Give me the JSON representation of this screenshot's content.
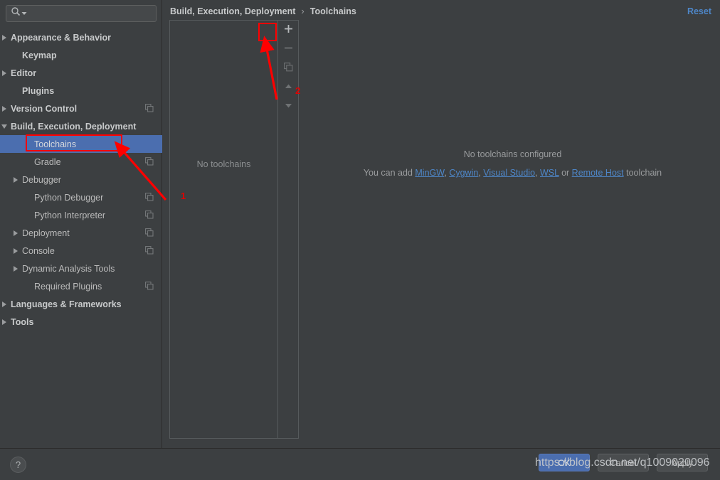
{
  "search": {
    "placeholder": "",
    "value": "",
    "icon": "search-icon",
    "dropdown_icon": "chevron-down-icon"
  },
  "sidebar": {
    "items": [
      {
        "label": "Appearance & Behavior",
        "twisty": "right",
        "bold": true,
        "indent": 14,
        "copy": false,
        "selected": false
      },
      {
        "label": "Keymap",
        "twisty": "none",
        "bold": true,
        "indent": 31,
        "copy": false,
        "selected": false
      },
      {
        "label": "Editor",
        "twisty": "right",
        "bold": true,
        "indent": 14,
        "copy": false,
        "selected": false
      },
      {
        "label": "Plugins",
        "twisty": "none",
        "bold": true,
        "indent": 31,
        "copy": false,
        "selected": false
      },
      {
        "label": "Version Control",
        "twisty": "right",
        "bold": true,
        "indent": 14,
        "copy": true,
        "selected": false
      },
      {
        "label": "Build, Execution, Deployment",
        "twisty": "down",
        "bold": true,
        "indent": 14,
        "copy": false,
        "selected": false
      },
      {
        "label": "Toolchains",
        "twisty": "none",
        "bold": false,
        "indent": 48,
        "copy": false,
        "selected": true
      },
      {
        "label": "Gradle",
        "twisty": "none",
        "bold": false,
        "indent": 48,
        "copy": true,
        "selected": false
      },
      {
        "label": "Debugger",
        "twisty": "right",
        "bold": false,
        "indent": 31,
        "copy": false,
        "selected": false
      },
      {
        "label": "Python Debugger",
        "twisty": "none",
        "bold": false,
        "indent": 48,
        "copy": true,
        "selected": false
      },
      {
        "label": "Python Interpreter",
        "twisty": "none",
        "bold": false,
        "indent": 48,
        "copy": true,
        "selected": false
      },
      {
        "label": "Deployment",
        "twisty": "right",
        "bold": false,
        "indent": 31,
        "copy": true,
        "selected": false
      },
      {
        "label": "Console",
        "twisty": "right",
        "bold": false,
        "indent": 31,
        "copy": true,
        "selected": false
      },
      {
        "label": "Dynamic Analysis Tools",
        "twisty": "right",
        "bold": false,
        "indent": 31,
        "copy": false,
        "selected": false
      },
      {
        "label": "Required Plugins",
        "twisty": "none",
        "bold": false,
        "indent": 48,
        "copy": true,
        "selected": false
      },
      {
        "label": "Languages & Frameworks",
        "twisty": "right",
        "bold": true,
        "indent": 14,
        "copy": false,
        "selected": false
      },
      {
        "label": "Tools",
        "twisty": "right",
        "bold": true,
        "indent": 14,
        "copy": false,
        "selected": false
      }
    ]
  },
  "header": {
    "breadcrumb_parent": "Build, Execution, Deployment",
    "breadcrumb_sep": "›",
    "breadcrumb_current": "Toolchains",
    "reset_label": "Reset"
  },
  "toolchain_list": {
    "empty_text": "No toolchains",
    "toolbar": [
      {
        "name": "add-toolchain-button",
        "icon": "plus-icon",
        "glyph": "+"
      },
      {
        "name": "remove-toolchain-button",
        "icon": "minus-icon",
        "glyph": "−"
      },
      {
        "name": "copy-toolchain-button",
        "icon": "copy-icon",
        "glyph": ""
      },
      {
        "name": "move-up-button",
        "icon": "arrow-up-icon",
        "glyph": ""
      },
      {
        "name": "move-down-button",
        "icon": "arrow-down-icon",
        "glyph": ""
      }
    ]
  },
  "empty_state": {
    "title": "No toolchains configured",
    "prefix": "You can add ",
    "links": [
      "MinGW",
      "Cygwin",
      "Visual Studio",
      "WSL",
      "Remote Host"
    ],
    "sep1": ", ",
    "sep2": " or ",
    "suffix": " toolchain"
  },
  "bottom": {
    "help_label": "?",
    "ok_label": "OK",
    "cancel_label": "Cancel",
    "apply_label": "Apply"
  },
  "annotations": {
    "num1": "1",
    "num2": "2",
    "watermark": "https://blog.csdn.net/q1009020096"
  },
  "colors": {
    "bg": "#3c3f41",
    "selection": "#4b6eaf",
    "link": "#4e86c7",
    "annotation_red": "#ff0000",
    "text": "#bbbbbb"
  }
}
